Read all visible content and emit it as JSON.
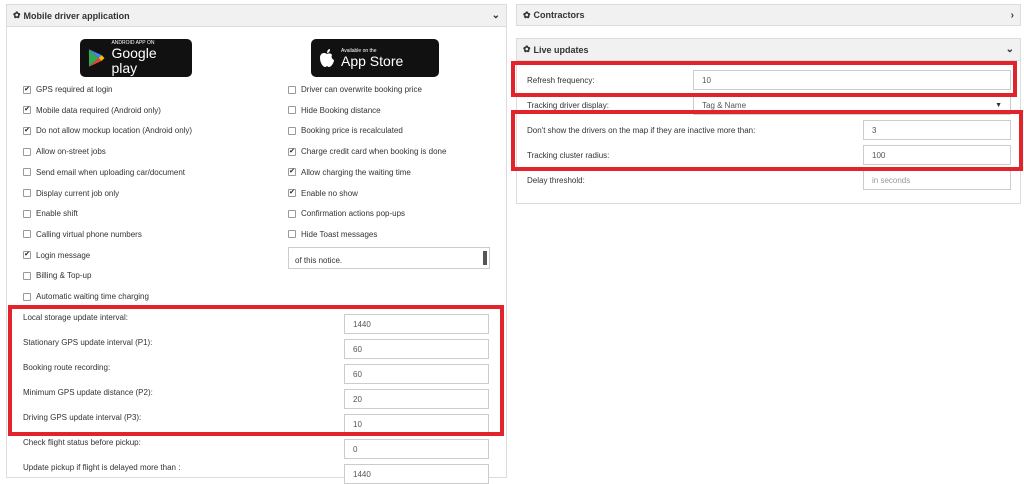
{
  "left_panel": {
    "title": "Mobile driver application",
    "badges": {
      "google": {
        "small": "ANDROID APP ON",
        "big": "Google play"
      },
      "apple": {
        "small": "Available on the",
        "big": "App Store"
      }
    },
    "left_checks": [
      {
        "label": "GPS required at login",
        "checked": true
      },
      {
        "label": "Mobile data required (Android only)",
        "checked": true
      },
      {
        "label": "Do not allow mockup location (Android only)",
        "checked": true
      },
      {
        "label": "Allow on-street jobs",
        "checked": false
      },
      {
        "label": "Send email when uploading car/document",
        "checked": false
      },
      {
        "label": "Display current job only",
        "checked": false
      },
      {
        "label": "Enable shift",
        "checked": false
      },
      {
        "label": "Calling virtual phone numbers",
        "checked": false
      },
      {
        "label": "Login message",
        "checked": true
      },
      {
        "label": "Billing & Top-up",
        "checked": false
      },
      {
        "label": "Automatic waiting time charging",
        "checked": false
      }
    ],
    "right_checks": [
      {
        "label": "Driver can overwrite booking price",
        "checked": false
      },
      {
        "label": "Hide Booking distance",
        "checked": false
      },
      {
        "label": "Booking price is recalculated",
        "checked": false
      },
      {
        "label": "Charge credit card when booking is done",
        "checked": true
      },
      {
        "label": "Allow charging the waiting time",
        "checked": true
      },
      {
        "label": "Enable no show",
        "checked": true
      },
      {
        "label": "Confirmation actions pop-ups",
        "checked": false
      },
      {
        "label": "Hide Toast messages",
        "checked": false
      }
    ],
    "login_message_text": "of this notice.",
    "fields": [
      {
        "label": "Local storage update interval:",
        "value": "1440"
      },
      {
        "label": "Stationary GPS update interval (P1):",
        "value": "60"
      },
      {
        "label": "Booking route recording:",
        "value": "60"
      },
      {
        "label": "Minimum GPS update distance (P2):",
        "value": "20"
      },
      {
        "label": "Driving GPS update interval (P3):",
        "value": "10"
      },
      {
        "label": "Check flight status before pickup:",
        "value": "0"
      },
      {
        "label": "Update pickup if flight is delayed more than :",
        "value": "1440"
      }
    ]
  },
  "contractors_panel": {
    "title": "Contractors"
  },
  "live_panel": {
    "title": "Live updates",
    "fields": [
      {
        "label": "Refresh frequency:",
        "value": "10",
        "placeholder": ""
      },
      {
        "label": "Tracking driver display:",
        "value": "Tag & Name",
        "placeholder": ""
      },
      {
        "label": "Don't show the drivers on the map if they are inactive more than:",
        "value": "3",
        "placeholder": ""
      },
      {
        "label": "Tracking cluster radius:",
        "value": "100",
        "placeholder": ""
      },
      {
        "label": "Delay threshold:",
        "value": "",
        "placeholder": "in seconds"
      }
    ]
  },
  "colors": {
    "highlight": "#e1232b",
    "header_bg": "#f1f1f1"
  }
}
